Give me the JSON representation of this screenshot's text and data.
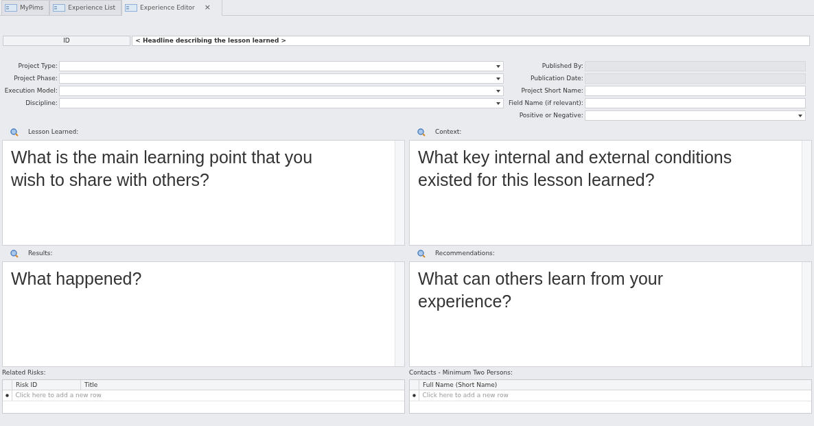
{
  "tabs": [
    {
      "label": "MyPims",
      "selected": false
    },
    {
      "label": "Experience List",
      "selected": false
    },
    {
      "label": "Experience Editor",
      "selected": true,
      "close": "×"
    }
  ],
  "header": {
    "id_label": "ID",
    "headline": "< Headline describing the lesson learned >"
  },
  "left_fields": [
    {
      "label": "Project Type:",
      "kind": "combo",
      "disabled": false
    },
    {
      "label": "Project Phase:",
      "kind": "combo",
      "disabled": false
    },
    {
      "label": "Execution Model:",
      "kind": "combo",
      "disabled": false
    },
    {
      "label": "Discipline:",
      "kind": "combo",
      "disabled": false
    }
  ],
  "right_fields": [
    {
      "label": "Published By:",
      "kind": "text",
      "disabled": true
    },
    {
      "label": "Publication Date:",
      "kind": "text",
      "disabled": true
    },
    {
      "label": "Project Short Name:",
      "kind": "text",
      "disabled": false
    },
    {
      "label": "Field Name (if relevant):",
      "kind": "text",
      "disabled": false
    },
    {
      "label": "Positive or Negative:",
      "kind": "combo",
      "disabled": false
    }
  ],
  "panels": [
    {
      "label": "Lesson Learned:",
      "text": "What is the main learning point that you wish to share with others?"
    },
    {
      "label": "Context:",
      "text": "What key internal and external conditions existed for this lesson learned?"
    },
    {
      "label": "Results:",
      "text": "What happened?"
    },
    {
      "label": "Recommendations:",
      "text": "What can others learn from your experience?"
    }
  ],
  "grids": [
    {
      "label": "Related Risks:",
      "columns": [
        "Risk ID",
        "Title"
      ],
      "new_row": "Click here to add a new row"
    },
    {
      "label": "Contacts - Minimum Two Persons:",
      "columns": [
        "Full Name (Short Name)"
      ],
      "new_row": "Click here to add a new row"
    }
  ]
}
